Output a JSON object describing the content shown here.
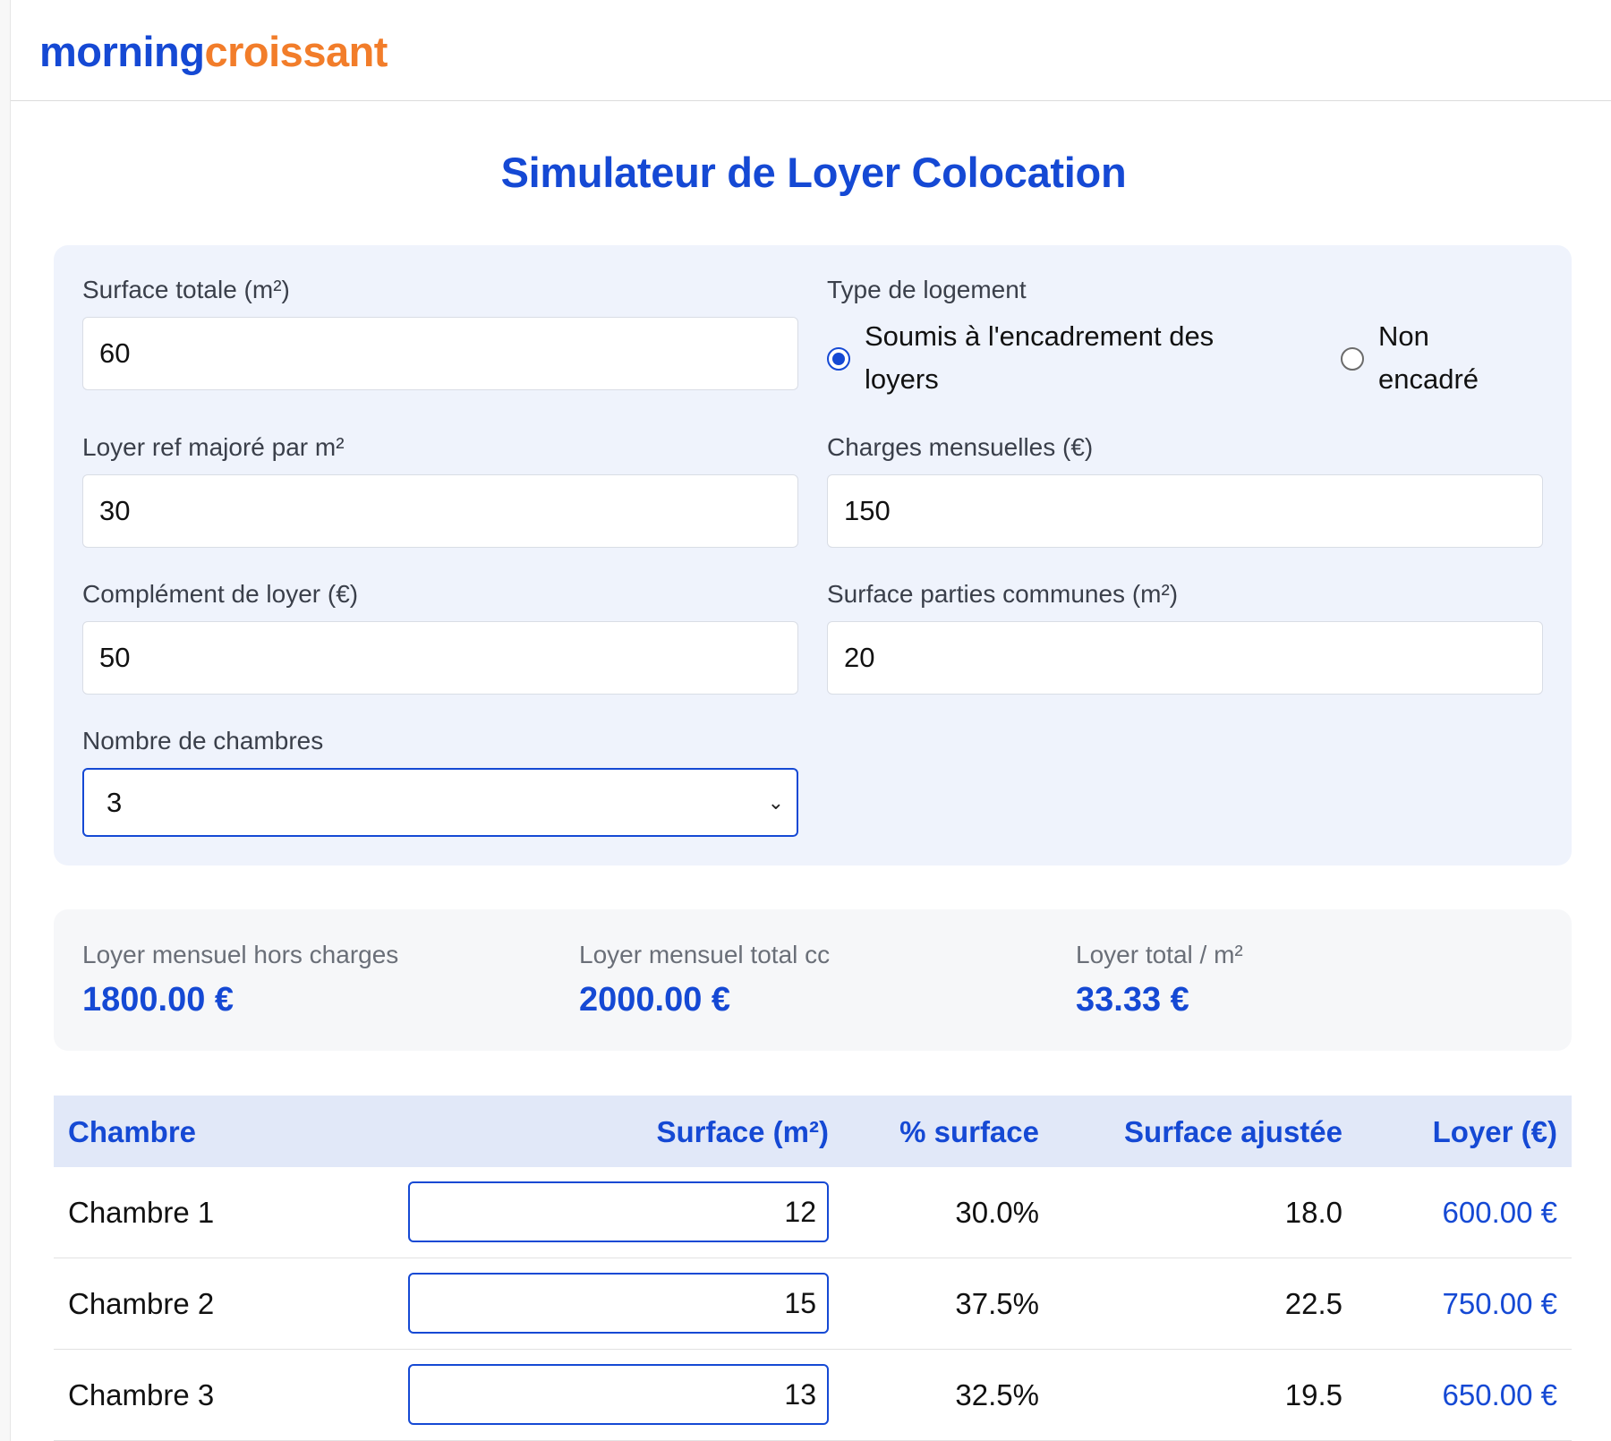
{
  "brand": {
    "part_a": "morning",
    "part_b": "croissant"
  },
  "page_title": "Simulateur de Loyer Colocation",
  "form": {
    "surface_totale": {
      "label": "Surface totale (m²)",
      "value": "60"
    },
    "type_logement": {
      "label": "Type de logement",
      "options": [
        {
          "line1": "Soumis à l'encadrement des",
          "line2": "loyers",
          "selected": true
        },
        {
          "line1": "Non",
          "line2": "encadré",
          "selected": false
        }
      ]
    },
    "loyer_ref": {
      "label": "Loyer ref majoré par m²",
      "value": "30"
    },
    "charges": {
      "label": "Charges mensuelles (€)",
      "value": "150"
    },
    "complement": {
      "label": "Complément de loyer (€)",
      "value": "50"
    },
    "parties_communes": {
      "label": "Surface parties communes (m²)",
      "value": "20"
    },
    "nb_chambres": {
      "label": "Nombre de chambres",
      "value": "3"
    }
  },
  "summary": {
    "hors_charges": {
      "label": "Loyer mensuel hors charges",
      "value": "1800.00 €"
    },
    "total_cc": {
      "label": "Loyer mensuel total cc",
      "value": "2000.00 €"
    },
    "par_m2": {
      "label": "Loyer total / m²",
      "value": "33.33 €"
    }
  },
  "table": {
    "headers": [
      "Chambre",
      "Surface (m²)",
      "% surface",
      "Surface ajustée",
      "Loyer (€)"
    ],
    "rows": [
      {
        "name": "Chambre 1",
        "surface": "12",
        "pct": "30.0%",
        "adjusted": "18.0",
        "rent": "600.00 €"
      },
      {
        "name": "Chambre 2",
        "surface": "15",
        "pct": "37.5%",
        "adjusted": "22.5",
        "rent": "750.00 €"
      },
      {
        "name": "Chambre 3",
        "surface": "13",
        "pct": "32.5%",
        "adjusted": "19.5",
        "rent": "650.00 €"
      }
    ]
  },
  "colors": {
    "accent": "#1549d4",
    "brand_orange": "#f27d2a"
  }
}
